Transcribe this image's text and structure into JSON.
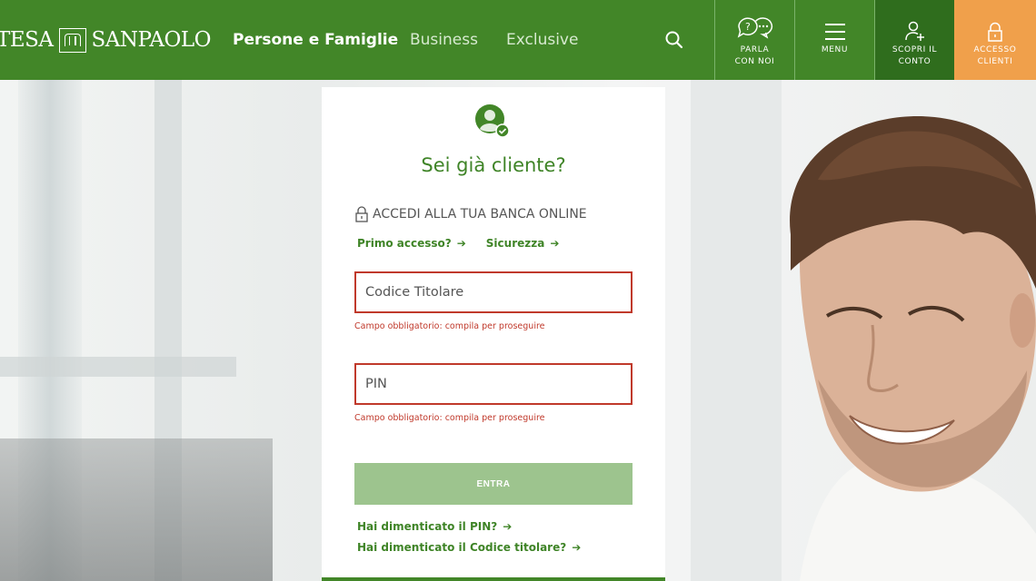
{
  "header": {
    "logo_left": "TESA",
    "logo_right": "SANPAOLO",
    "nav": {
      "persone": "Persone e Famiglie",
      "business": "Business",
      "exclusive": "Exclusive"
    },
    "buttons": {
      "parla": [
        "PARLA",
        "CON NOI"
      ],
      "menu": "MENU",
      "scopri": [
        "SCOPRI IL",
        "CONTO"
      ],
      "accesso": [
        "ACCESSO",
        "CLIENTI"
      ]
    }
  },
  "login": {
    "title": "Sei già cliente?",
    "section_label": "ACCEDI ALLA TUA BANCA ONLINE",
    "primo_accesso": "Primo accesso?",
    "sicurezza": "Sicurezza",
    "codice_placeholder": "Codice Titolare",
    "codice_value": "",
    "codice_error": "Campo obbligatorio: compila per proseguire",
    "pin_placeholder": "PIN",
    "pin_value": "",
    "pin_error": "Campo obbligatorio: compila per proseguire",
    "entra": "ENTRA",
    "forgot_pin": "Hai dimenticato il PIN?",
    "forgot_codice": "Hai dimenticato il Codice titolare?",
    "arrow": "➔"
  },
  "colors": {
    "brand_green": "#428628",
    "dark_green": "#2f6d1d",
    "accent_orange": "#f0a04b",
    "error_red": "#c0392b",
    "button_disabled_green": "#9dc48e"
  },
  "icons": {
    "search": "search-icon",
    "chat": "chat-icon",
    "menu": "hamburger-icon",
    "add_user": "add-user-icon",
    "lock": "lock-icon",
    "user_check": "user-check-icon"
  }
}
